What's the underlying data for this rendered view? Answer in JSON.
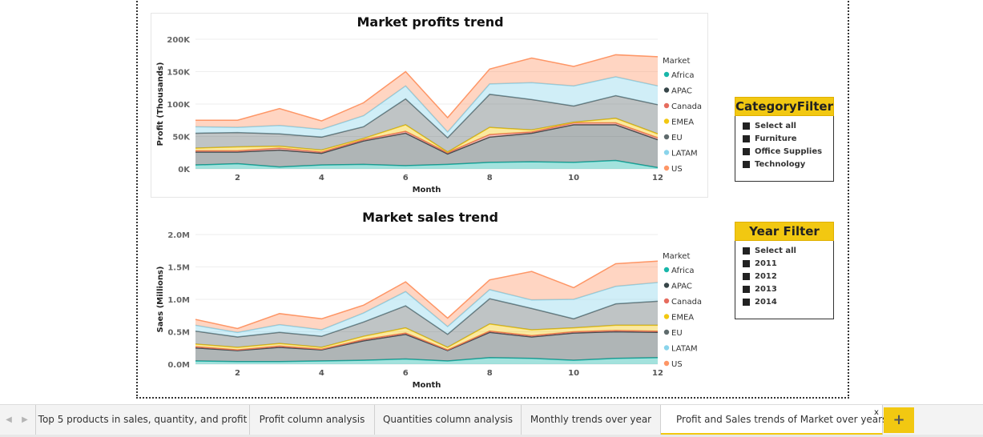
{
  "canvas": {
    "chart1": {
      "title": "Market profits trend",
      "ylabel": "Profit (Thousands)",
      "xlabel": "Month",
      "yticks": [
        "0K",
        "50K",
        "100K",
        "150K",
        "200K"
      ],
      "xticks": [
        "2",
        "4",
        "6",
        "8",
        "10",
        "12"
      ],
      "legend_title": "Market",
      "legend": [
        "Africa",
        "APAC",
        "Canada",
        "EMEA",
        "EU",
        "LATAM",
        "US"
      ]
    },
    "chart2": {
      "title": "Market sales trend",
      "ylabel": "Saes (Millions)",
      "xlabel": "Month",
      "yticks": [
        "0.0M",
        "0.5M",
        "1.0M",
        "1.5M",
        "2.0M"
      ],
      "xticks": [
        "2",
        "4",
        "6",
        "8",
        "10",
        "12"
      ],
      "legend_title": "Market",
      "legend": [
        "Africa",
        "APAC",
        "Canada",
        "EMEA",
        "EU",
        "LATAM",
        "US"
      ]
    },
    "category_filter": {
      "title": "CategoryFilter",
      "items": [
        "Select all",
        "Furniture",
        "Office Supplies",
        "Technology"
      ]
    },
    "year_filter": {
      "title": "Year Filter",
      "items": [
        "Select all",
        "2011",
        "2012",
        "2013",
        "2014"
      ]
    }
  },
  "tabs": {
    "nav_prev": "◀",
    "nav_next": "▶",
    "items": [
      "Top 5 products in sales, quantity, and profit",
      "Profit column analysis",
      "Quantities column analysis",
      "Monthly trends over year",
      "Profit and Sales trends of Market over years"
    ],
    "active_index": 4,
    "close": "x",
    "add": "+"
  },
  "colors": {
    "Africa": "#18b6a9",
    "APAC": "#374649",
    "Canada": "#e66c5e",
    "EMEA": "#f2c811",
    "EU": "#5f6b6d",
    "LATAM": "#8ad4eb",
    "US": "#fe9666",
    "accent": "#f2c811"
  },
  "chart_data": [
    {
      "type": "area",
      "stacked": true,
      "title": "Market profits trend",
      "xlabel": "Month",
      "ylabel": "Profit (Thousands)",
      "x": [
        1,
        2,
        3,
        4,
        5,
        6,
        7,
        8,
        9,
        10,
        11,
        12
      ],
      "xlim": [
        1,
        12
      ],
      "ylim": [
        0,
        200000
      ],
      "legend_position": "right",
      "series": [
        {
          "name": "Africa",
          "values": [
            6000,
            8000,
            3000,
            6000,
            7000,
            5000,
            7000,
            10000,
            11000,
            10000,
            13000,
            2000
          ]
        },
        {
          "name": "APAC",
          "values": [
            20000,
            18000,
            26000,
            18000,
            36000,
            50000,
            16000,
            39000,
            44000,
            58000,
            55000,
            43000
          ]
        },
        {
          "name": "Canada",
          "values": [
            2000,
            2000,
            3000,
            2000,
            2000,
            3000,
            2000,
            4000,
            2000,
            3000,
            3000,
            3000
          ]
        },
        {
          "name": "EMEA",
          "values": [
            4000,
            6000,
            3000,
            3000,
            2000,
            10000,
            1000,
            11000,
            3000,
            1000,
            7000,
            6000
          ]
        },
        {
          "name": "EU",
          "values": [
            23000,
            22000,
            19000,
            20000,
            18000,
            40000,
            22000,
            51000,
            47000,
            25000,
            35000,
            45000
          ]
        },
        {
          "name": "LATAM",
          "values": [
            10000,
            8000,
            13000,
            12000,
            17000,
            20000,
            9000,
            16000,
            26000,
            31000,
            29000,
            29000
          ]
        },
        {
          "name": "US",
          "values": [
            10000,
            11000,
            26000,
            13000,
            20000,
            22000,
            22000,
            23000,
            38000,
            30000,
            34000,
            45000
          ]
        }
      ]
    },
    {
      "type": "area",
      "stacked": true,
      "title": "Market sales trend",
      "xlabel": "Month",
      "ylabel": "Saes (Millions)",
      "x": [
        1,
        2,
        3,
        4,
        5,
        6,
        7,
        8,
        9,
        10,
        11,
        12
      ],
      "xlim": [
        1,
        12
      ],
      "ylim": [
        0,
        2000000
      ],
      "legend_position": "right",
      "series": [
        {
          "name": "Africa",
          "values": [
            50000,
            40000,
            40000,
            50000,
            60000,
            80000,
            50000,
            100000,
            90000,
            60000,
            90000,
            100000
          ]
        },
        {
          "name": "APAC",
          "values": [
            200000,
            170000,
            220000,
            170000,
            300000,
            380000,
            160000,
            390000,
            330000,
            420000,
            410000,
            390000
          ]
        },
        {
          "name": "Canada",
          "values": [
            20000,
            10000,
            20000,
            10000,
            20000,
            20000,
            10000,
            20000,
            20000,
            20000,
            20000,
            20000
          ]
        },
        {
          "name": "EMEA",
          "values": [
            40000,
            40000,
            40000,
            30000,
            50000,
            80000,
            40000,
            110000,
            90000,
            60000,
            80000,
            90000
          ]
        },
        {
          "name": "EU",
          "values": [
            200000,
            160000,
            170000,
            170000,
            220000,
            340000,
            200000,
            390000,
            330000,
            140000,
            330000,
            370000
          ]
        },
        {
          "name": "LATAM",
          "values": [
            90000,
            70000,
            120000,
            100000,
            140000,
            220000,
            120000,
            140000,
            130000,
            300000,
            270000,
            290000
          ]
        },
        {
          "name": "US",
          "values": [
            90000,
            60000,
            170000,
            170000,
            120000,
            150000,
            130000,
            150000,
            440000,
            180000,
            350000,
            330000
          ]
        }
      ]
    }
  ]
}
